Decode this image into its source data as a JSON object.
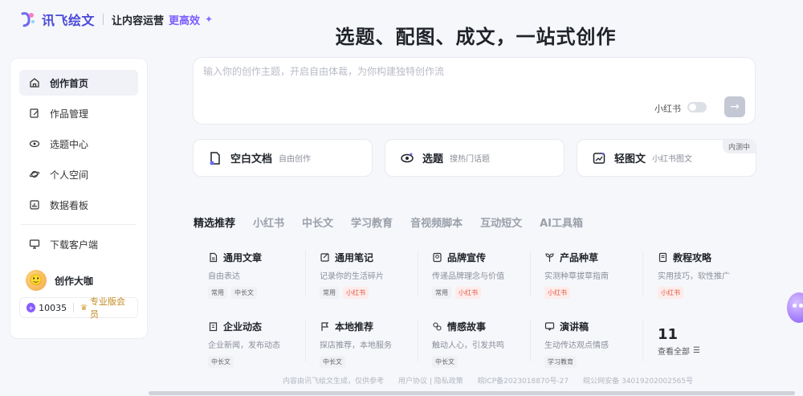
{
  "brand": {
    "name": "讯飞绘文",
    "tagline": "让内容运营",
    "tagline_highlight": "更高效",
    "accent": "#4a4ad6"
  },
  "hero": {
    "title": "选题、配图、成文，一站式创作"
  },
  "sidebar": {
    "items": [
      {
        "label": "创作首页",
        "icon": "home-icon",
        "active": true
      },
      {
        "label": "作品管理",
        "icon": "edit-doc-icon"
      },
      {
        "label": "选题中心",
        "icon": "eye-icon"
      },
      {
        "label": "个人空间",
        "icon": "planet-icon"
      },
      {
        "label": "数据看板",
        "icon": "chart-icon"
      }
    ],
    "download": {
      "label": "下载客户端",
      "icon": "monitor-icon"
    },
    "user": {
      "name": "创作大咖",
      "points": "10035",
      "membership": "专业版会员"
    }
  },
  "prompt": {
    "placeholder": "输入你的创作主题，开启自由体裁，为你构建独特创作流",
    "toggle_label": "小红书",
    "send_icon": "arrow-right-icon"
  },
  "quick_cards": [
    {
      "title": "空白文档",
      "sub": "自由创作",
      "icon": "blank-doc-icon"
    },
    {
      "title": "选题",
      "sub": "搜热门话题",
      "icon": "eye-icon"
    },
    {
      "title": "轻图文",
      "sub": "小红书图文",
      "icon": "image-text-icon",
      "badge": "内测中"
    }
  ],
  "tabs": [
    "精选推荐",
    "小红书",
    "中长文",
    "学习教育",
    "音视频脚本",
    "互动短文",
    "AI工具箱"
  ],
  "templates": [
    {
      "title": "通用文章",
      "desc": "自由表达",
      "tags": [
        {
          "t": "常用",
          "c": "gray"
        },
        {
          "t": "中长文",
          "c": "gray"
        }
      ],
      "icon": "doc-icon"
    },
    {
      "title": "通用笔记",
      "desc": "记录你的生活碎片",
      "tags": [
        {
          "t": "常用",
          "c": "gray"
        },
        {
          "t": "小红书",
          "c": "red"
        }
      ],
      "icon": "note-icon"
    },
    {
      "title": "品牌宣传",
      "desc": "传递品牌理念与价值",
      "tags": [
        {
          "t": "常用",
          "c": "gray"
        },
        {
          "t": "小红书",
          "c": "red"
        }
      ],
      "icon": "badge-icon"
    },
    {
      "title": "产品种草",
      "desc": "实测种草拔草指南",
      "tags": [
        {
          "t": "小红书",
          "c": "red"
        }
      ],
      "icon": "sprout-icon"
    },
    {
      "title": "教程攻略",
      "desc": "实用技巧，软性推广",
      "tags": [
        {
          "t": "小红书",
          "c": "red"
        }
      ],
      "icon": "book-icon"
    },
    {
      "title": "企业动态",
      "desc": "企业新闻，发布动态",
      "tags": [
        {
          "t": "中长文",
          "c": "gray"
        }
      ],
      "icon": "building-icon"
    },
    {
      "title": "本地推荐",
      "desc": "探店推荐，本地服务",
      "tags": [
        {
          "t": "中长文",
          "c": "gray"
        }
      ],
      "icon": "flag-icon"
    },
    {
      "title": "情感故事",
      "desc": "触动人心，引发共鸣",
      "tags": [
        {
          "t": "中长文",
          "c": "gray"
        }
      ],
      "icon": "heart-story-icon"
    },
    {
      "title": "演讲稿",
      "desc": "生动传达观点情感",
      "tags": [
        {
          "t": "学习教育",
          "c": "gray"
        }
      ],
      "icon": "speech-icon"
    }
  ],
  "more": {
    "count": "11",
    "label": "查看全部"
  },
  "footer": {
    "disclaimer": "内容由讯飞绘文生成，仅供参考",
    "links": "用户协议 | 隐私政策",
    "icp": "皖ICP备2023018870号-27",
    "police": "皖公网安备 34019202002565号"
  }
}
